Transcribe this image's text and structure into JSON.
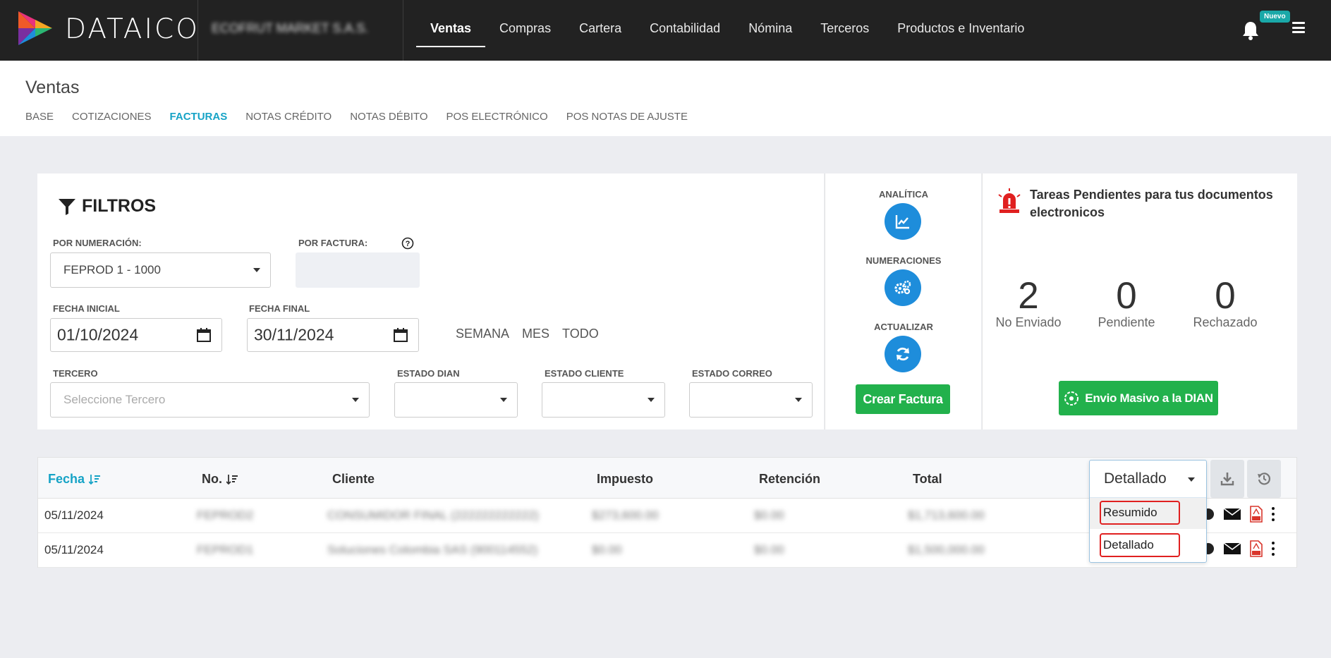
{
  "app": {
    "brand": "DATAICO",
    "company": "ECOFRUT MARKET S.A.S."
  },
  "nav": {
    "items": [
      "Ventas",
      "Compras",
      "Cartera",
      "Contabilidad",
      "Nómina",
      "Terceros",
      "Productos e Inventario"
    ],
    "active": "Ventas",
    "badge": "Nuevo"
  },
  "page": {
    "title": "Ventas",
    "subtabs": [
      "BASE",
      "COTIZACIONES",
      "FACTURAS",
      "NOTAS CRÉDITO",
      "NOTAS DÉBITO",
      "POS ELECTRÓNICO",
      "POS NOTAS DE AJUSTE"
    ],
    "active_subtab": "FACTURAS"
  },
  "filters": {
    "title": "FILTROS",
    "numeracion_label": "POR NUMERACIÓN:",
    "numeracion_value": "FEPROD 1 - 1000",
    "factura_label": "POR FACTURA:",
    "factura_value": "",
    "fecha_inicial_label": "FECHA INICIAL",
    "fecha_inicial_value": "01/10/2024",
    "fecha_final_label": "FECHA FINAL",
    "fecha_final_value": "30/11/2024",
    "range_links": [
      "SEMANA",
      "MES",
      "TODO"
    ],
    "tercero_label": "TERCERO",
    "tercero_placeholder": "Seleccione Tercero",
    "estado_dian_label": "ESTADO DIAN",
    "estado_cliente_label": "ESTADO CLIENTE",
    "estado_correo_label": "ESTADO CORREO"
  },
  "quick_actions": {
    "analitica": "ANALÍTICA",
    "numeraciones": "NUMERACIONES",
    "actualizar": "ACTUALIZAR",
    "crear_factura": "Crear Factura"
  },
  "tasks": {
    "title": "Tareas Pendientes para tus documentos electronicos",
    "stats": [
      {
        "value": "2",
        "label": "No Enviado"
      },
      {
        "value": "0",
        "label": "Pendiente"
      },
      {
        "value": "0",
        "label": "Rechazado"
      }
    ],
    "envio_masivo": "Envio Masivo a la DIAN"
  },
  "table": {
    "columns": [
      "Fecha",
      "No.",
      "Cliente",
      "Impuesto",
      "Retención",
      "Total"
    ],
    "rows": [
      {
        "fecha": "05/11/2024",
        "no": "FEPROD2",
        "cliente": "CONSUMIDOR FINAL (222222222222)",
        "impuesto": "$273,600.00",
        "retencion": "$0.00",
        "total": "$1,713,600.00"
      },
      {
        "fecha": "05/11/2024",
        "no": "FEPROD1",
        "cliente": "Soluciones Colombia SAS (900114552)",
        "impuesto": "$0.00",
        "retencion": "$0.00",
        "total": "$1,500,000.00"
      }
    ],
    "view_select": {
      "value": "Detallado",
      "options": [
        "Resumido",
        "Detallado"
      ]
    }
  },
  "colors": {
    "topbar": "#222222",
    "accent": "#16a3c6",
    "action_blue": "#1e8ddb",
    "green": "#22b14c",
    "alert_red": "#e02020"
  }
}
